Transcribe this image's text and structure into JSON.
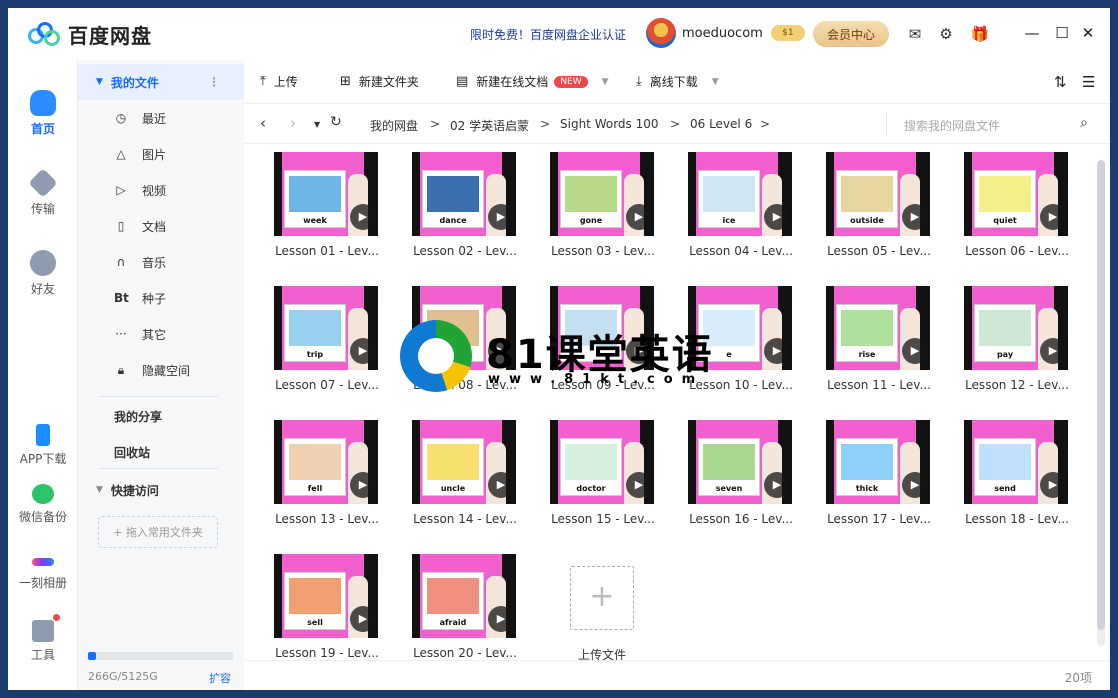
{
  "app": {
    "title": "百度网盘"
  },
  "titlebar": {
    "promo": "限时免费！百度网盘企业认证",
    "username": "moeduocom",
    "vip_level": "1",
    "member_center": "会员中心"
  },
  "nav": {
    "home": "首页",
    "transfer": "传输",
    "friends": "好友",
    "app_download": "APP下载",
    "wechat_backup": "微信备份",
    "album": "一刻相册",
    "tools": "工具"
  },
  "side": {
    "my_files": "我的文件",
    "recent": "最近",
    "images": "图片",
    "videos": "视频",
    "docs": "文档",
    "music": "音乐",
    "torrents": "种子",
    "others": "其它",
    "hidden_space": "隐藏空间",
    "my_share": "我的分享",
    "recycle": "回收站",
    "quick_access": "快捷访问",
    "add_common_folder": "+ 拖入常用文件夹",
    "storage": "266G/5125G",
    "storage_used_fraction": 0.052,
    "expand": "扩容"
  },
  "toolbar": {
    "upload": "上传",
    "new_folder": "新建文件夹",
    "new_online_doc": "新建在线文档",
    "new_badge": "NEW",
    "offline_download": "离线下载"
  },
  "path": {
    "crumbs": [
      "我的网盘",
      "02 学英语启蒙",
      "Sight Words 100",
      "06 Level 6"
    ],
    "search_placeholder": "搜索我的网盘文件"
  },
  "files": [
    {
      "name": "Lesson 01 - Lev...",
      "word": "week"
    },
    {
      "name": "Lesson 02 - Lev...",
      "word": "dance"
    },
    {
      "name": "Lesson 03 - Lev...",
      "word": "gone"
    },
    {
      "name": "Lesson 04 - Lev...",
      "word": "ice"
    },
    {
      "name": "Lesson 05 - Lev...",
      "word": "outside"
    },
    {
      "name": "Lesson 06 - Lev...",
      "word": "quiet"
    },
    {
      "name": "Lesson 07 - Lev...",
      "word": "trip"
    },
    {
      "name": "Lesson 08 - Lev...",
      "word": ""
    },
    {
      "name": "Lesson 09 - Lev...",
      "word": ""
    },
    {
      "name": "Lesson 10 - Lev...",
      "word": "e"
    },
    {
      "name": "Lesson 11 - Lev...",
      "word": "rise"
    },
    {
      "name": "Lesson 12 - Lev...",
      "word": "pay"
    },
    {
      "name": "Lesson 13 - Lev...",
      "word": "fell"
    },
    {
      "name": "Lesson 14 - Lev...",
      "word": "uncle"
    },
    {
      "name": "Lesson 15 - Lev...",
      "word": "doctor"
    },
    {
      "name": "Lesson 16 - Lev...",
      "word": "seven"
    },
    {
      "name": "Lesson 17 - Lev...",
      "word": "thick"
    },
    {
      "name": "Lesson 18 - Lev...",
      "word": "send"
    },
    {
      "name": "Lesson 19 - Lev...",
      "word": "sell"
    },
    {
      "name": "Lesson 20 - Lev...",
      "word": "afraid"
    }
  ],
  "upload_tile": {
    "label": "上传文件"
  },
  "status": {
    "count": "20项"
  },
  "watermark": {
    "title": "81课堂英语",
    "url": "www.81kt.com"
  },
  "colors": {
    "accent": "#1a6cff",
    "thumb_bg": "#f25fcf",
    "vip_gold": "#e9c48a"
  }
}
